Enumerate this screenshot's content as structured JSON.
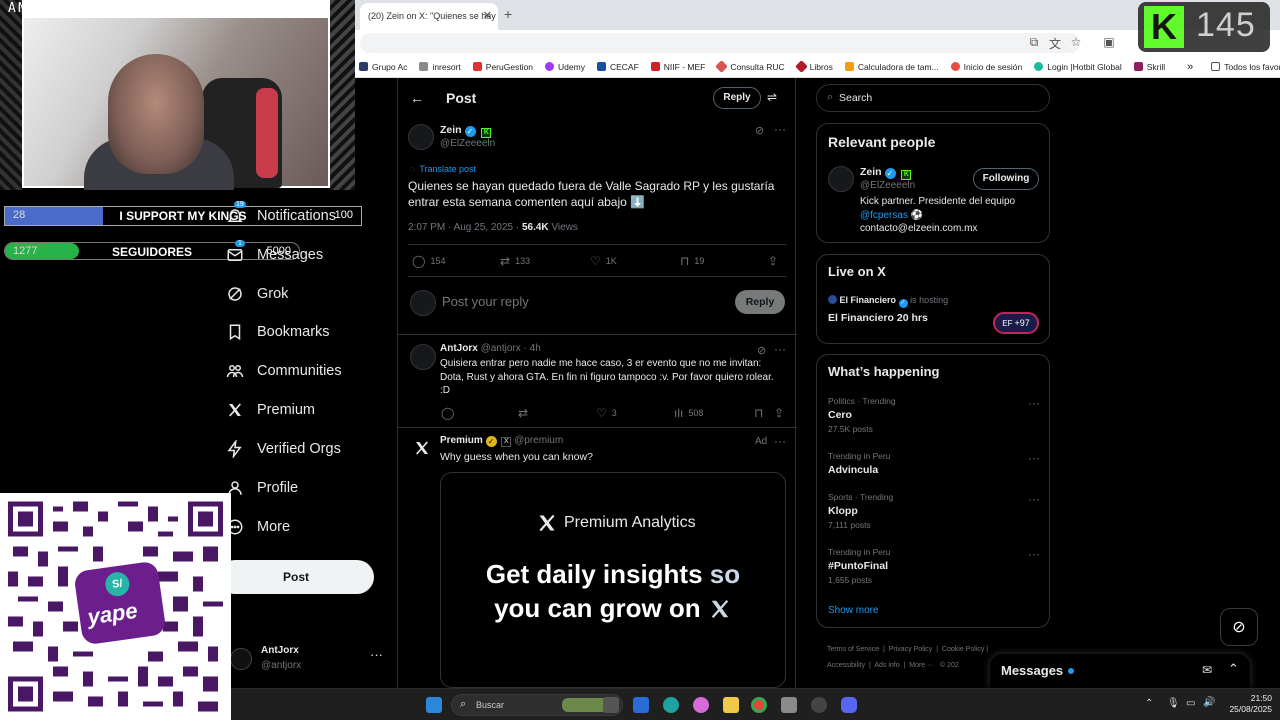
{
  "stream": {
    "name": "ANTJORX",
    "kick_count": "145",
    "bar1": {
      "left": "28",
      "center": "I SUPPORT MY KINGS",
      "right": "100"
    },
    "bar2": {
      "left": "1277",
      "center": "SEGUIDORES",
      "right": "5000"
    }
  },
  "browser": {
    "tab_title": "(20) Zein on X: \"Quienes se hay",
    "bookmarks": [
      "Grupo Ac",
      "inresort",
      "PeruGestion",
      "Udemy",
      "CECAF",
      "NIIF - MEF",
      "Consulta RUC",
      "Libros",
      "Calculadora de tam...",
      "Inicio de sesión",
      "Login |Hotbit Global",
      "Skrill"
    ],
    "bookmarks_all": "Todos los favoritos"
  },
  "nav": {
    "notifications": "Notifications",
    "notifications_badge": "19",
    "messages": "Messages",
    "messages_badge": "1",
    "grok": "Grok",
    "bookmarks": "Bookmarks",
    "communities": "Communities",
    "premium": "Premium",
    "verified_orgs": "Verified Orgs",
    "profile": "Profile",
    "more": "More",
    "post": "Post",
    "account_name": "AntJorx",
    "account_handle": "@antjorx"
  },
  "header": {
    "title": "Post",
    "reply": "Reply"
  },
  "post": {
    "name": "Zein",
    "handle": "@ElZeeeeln",
    "translate": "Translate post",
    "text": "Quienes se hayan quedado fuera de Valle Sagrado RP y les gustaría entrar esta semana comenten aquí abajo ⬇️",
    "time": "2:07 PM · Aug 25, 2025 ·",
    "views_count": "56.4K",
    "views_label": "Views",
    "replies": "154",
    "reposts": "133",
    "likes": "1K",
    "bookmarks": "19"
  },
  "reply_box": {
    "placeholder": "Post your reply",
    "button": "Reply"
  },
  "replies": [
    {
      "name": "AntJorx",
      "handle": "@antjorx · 4h",
      "text": "Quisiera entrar pero nadie me hace caso, 3 er evento que no me invitan: Dota, Rust y ahora GTA. En fin ni figuro tampoco :v. Por favor quiero rolear. :D",
      "likes": "3",
      "views": "508"
    }
  ],
  "ad": {
    "name": "Premium",
    "handle": "@premium",
    "tag": "Ad",
    "text": "Why guess when you can know?",
    "banner_title": "Premium Analytics",
    "banner_line1": "Get daily insights",
    "banner_so": "so",
    "banner_line2": "you can grow on"
  },
  "sidebar": {
    "search_placeholder": "Search",
    "relevant_title": "Relevant people",
    "person": {
      "name": "Zein",
      "handle": "@ElZeeeeln",
      "follow": "Following",
      "bio1": "Kick partner. Presidente del equipo",
      "bio_link": "@fcpersas",
      "bio2": "contacto@elzeein.com.mx"
    },
    "live_title": "Live on X",
    "live_host": "El Financiero",
    "live_hosting": "is hosting",
    "live_show": "El Financiero 20 hrs",
    "live_count": "+97",
    "happening_title": "What’s happening",
    "trends": [
      {
        "cat": "Politics · Trending",
        "name": "Cero",
        "count": "27.5K posts"
      },
      {
        "cat": "Trending in Peru",
        "name": "Advincula",
        "count": ""
      },
      {
        "cat": "Sports · Trending",
        "name": "Klopp",
        "count": "7,111 posts"
      },
      {
        "cat": "Trending in Peru",
        "name": "#PuntoFinal",
        "count": "1,655 posts"
      }
    ],
    "show_more": "Show more",
    "footer": [
      "Terms of Service",
      "Privacy Policy",
      "Cookie Policy",
      "Accessibility",
      "Ads info",
      "More ···",
      "© 202"
    ]
  },
  "messages_drawer": "Messages",
  "taskbar": {
    "search": "Buscar",
    "time": "21:50",
    "date": "25/08/2025"
  }
}
